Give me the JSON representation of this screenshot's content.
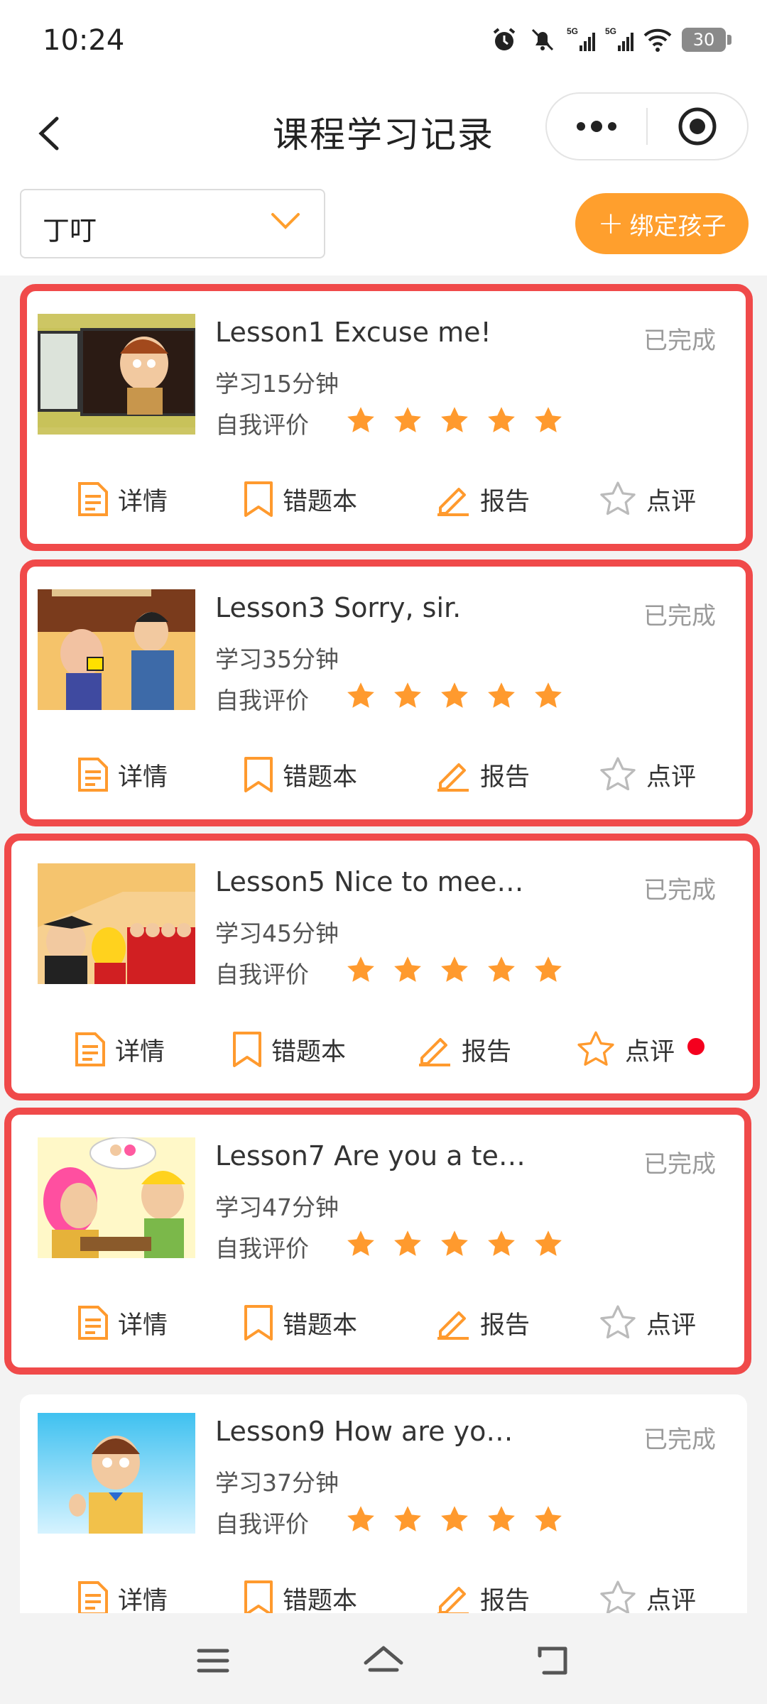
{
  "status_bar": {
    "time": "10:24",
    "battery": "30",
    "signal1": "5G",
    "signal2": "5G"
  },
  "nav": {
    "title": "课程学习记录"
  },
  "filter": {
    "child_name": "丁叮",
    "bind_label": "绑定孩子"
  },
  "colors": {
    "accent": "#ff9f2d",
    "highlight": "#f04a4a",
    "star": "#ff9a2e",
    "dot": "#f4001e"
  },
  "lessons": [
    {
      "title": "Lesson1 Excuse me!",
      "duration": "学习15分钟",
      "rating_label": "自我评价",
      "rating": 5,
      "status": "已完成",
      "actions": {
        "details": "详情",
        "mistakes": "错题本",
        "report": "报告",
        "review": "点评"
      },
      "has_new_review": false
    },
    {
      "title": "Lesson3 Sorry, sir.",
      "duration": "学习35分钟",
      "rating_label": "自我评价",
      "rating": 5,
      "status": "已完成",
      "actions": {
        "details": "详情",
        "mistakes": "错题本",
        "report": "报告",
        "review": "点评"
      },
      "has_new_review": false
    },
    {
      "title": "Lesson5 Nice to mee…",
      "duration": "学习45分钟",
      "rating_label": "自我评价",
      "rating": 5,
      "status": "已完成",
      "actions": {
        "details": "详情",
        "mistakes": "错题本",
        "report": "报告",
        "review": "点评"
      },
      "has_new_review": true
    },
    {
      "title": "Lesson7 Are you a te…",
      "duration": "学习47分钟",
      "rating_label": "自我评价",
      "rating": 5,
      "status": "已完成",
      "actions": {
        "details": "详情",
        "mistakes": "错题本",
        "report": "报告",
        "review": "点评"
      },
      "has_new_review": false
    },
    {
      "title": "Lesson9 How are yo…",
      "duration": "学习37分钟",
      "rating_label": "自我评价",
      "rating": 5,
      "status": "已完成",
      "actions": {
        "details": "详情",
        "mistakes": "错题本",
        "report": "报告",
        "review": "点评"
      },
      "has_new_review": false
    }
  ]
}
